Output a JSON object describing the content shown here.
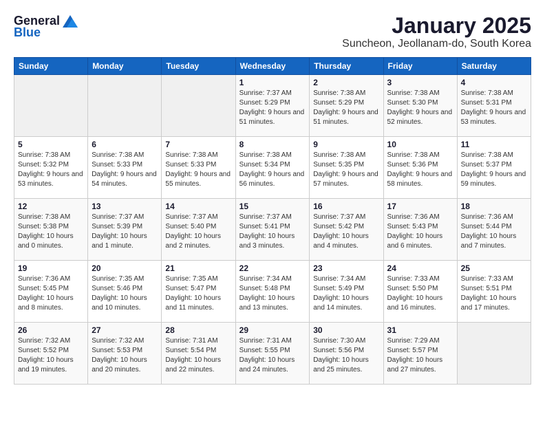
{
  "header": {
    "logo_general": "General",
    "logo_blue": "Blue",
    "title": "January 2025",
    "subtitle": "Suncheon, Jeollanam-do, South Korea"
  },
  "days_header": [
    "Sunday",
    "Monday",
    "Tuesday",
    "Wednesday",
    "Thursday",
    "Friday",
    "Saturday"
  ],
  "weeks": [
    [
      {
        "day": "",
        "info": ""
      },
      {
        "day": "",
        "info": ""
      },
      {
        "day": "",
        "info": ""
      },
      {
        "day": "1",
        "info": "Sunrise: 7:37 AM\nSunset: 5:29 PM\nDaylight: 9 hours and 51 minutes."
      },
      {
        "day": "2",
        "info": "Sunrise: 7:38 AM\nSunset: 5:29 PM\nDaylight: 9 hours and 51 minutes."
      },
      {
        "day": "3",
        "info": "Sunrise: 7:38 AM\nSunset: 5:30 PM\nDaylight: 9 hours and 52 minutes."
      },
      {
        "day": "4",
        "info": "Sunrise: 7:38 AM\nSunset: 5:31 PM\nDaylight: 9 hours and 53 minutes."
      }
    ],
    [
      {
        "day": "5",
        "info": "Sunrise: 7:38 AM\nSunset: 5:32 PM\nDaylight: 9 hours and 53 minutes."
      },
      {
        "day": "6",
        "info": "Sunrise: 7:38 AM\nSunset: 5:33 PM\nDaylight: 9 hours and 54 minutes."
      },
      {
        "day": "7",
        "info": "Sunrise: 7:38 AM\nSunset: 5:33 PM\nDaylight: 9 hours and 55 minutes."
      },
      {
        "day": "8",
        "info": "Sunrise: 7:38 AM\nSunset: 5:34 PM\nDaylight: 9 hours and 56 minutes."
      },
      {
        "day": "9",
        "info": "Sunrise: 7:38 AM\nSunset: 5:35 PM\nDaylight: 9 hours and 57 minutes."
      },
      {
        "day": "10",
        "info": "Sunrise: 7:38 AM\nSunset: 5:36 PM\nDaylight: 9 hours and 58 minutes."
      },
      {
        "day": "11",
        "info": "Sunrise: 7:38 AM\nSunset: 5:37 PM\nDaylight: 9 hours and 59 minutes."
      }
    ],
    [
      {
        "day": "12",
        "info": "Sunrise: 7:38 AM\nSunset: 5:38 PM\nDaylight: 10 hours and 0 minutes."
      },
      {
        "day": "13",
        "info": "Sunrise: 7:37 AM\nSunset: 5:39 PM\nDaylight: 10 hours and 1 minute."
      },
      {
        "day": "14",
        "info": "Sunrise: 7:37 AM\nSunset: 5:40 PM\nDaylight: 10 hours and 2 minutes."
      },
      {
        "day": "15",
        "info": "Sunrise: 7:37 AM\nSunset: 5:41 PM\nDaylight: 10 hours and 3 minutes."
      },
      {
        "day": "16",
        "info": "Sunrise: 7:37 AM\nSunset: 5:42 PM\nDaylight: 10 hours and 4 minutes."
      },
      {
        "day": "17",
        "info": "Sunrise: 7:36 AM\nSunset: 5:43 PM\nDaylight: 10 hours and 6 minutes."
      },
      {
        "day": "18",
        "info": "Sunrise: 7:36 AM\nSunset: 5:44 PM\nDaylight: 10 hours and 7 minutes."
      }
    ],
    [
      {
        "day": "19",
        "info": "Sunrise: 7:36 AM\nSunset: 5:45 PM\nDaylight: 10 hours and 8 minutes."
      },
      {
        "day": "20",
        "info": "Sunrise: 7:35 AM\nSunset: 5:46 PM\nDaylight: 10 hours and 10 minutes."
      },
      {
        "day": "21",
        "info": "Sunrise: 7:35 AM\nSunset: 5:47 PM\nDaylight: 10 hours and 11 minutes."
      },
      {
        "day": "22",
        "info": "Sunrise: 7:34 AM\nSunset: 5:48 PM\nDaylight: 10 hours and 13 minutes."
      },
      {
        "day": "23",
        "info": "Sunrise: 7:34 AM\nSunset: 5:49 PM\nDaylight: 10 hours and 14 minutes."
      },
      {
        "day": "24",
        "info": "Sunrise: 7:33 AM\nSunset: 5:50 PM\nDaylight: 10 hours and 16 minutes."
      },
      {
        "day": "25",
        "info": "Sunrise: 7:33 AM\nSunset: 5:51 PM\nDaylight: 10 hours and 17 minutes."
      }
    ],
    [
      {
        "day": "26",
        "info": "Sunrise: 7:32 AM\nSunset: 5:52 PM\nDaylight: 10 hours and 19 minutes."
      },
      {
        "day": "27",
        "info": "Sunrise: 7:32 AM\nSunset: 5:53 PM\nDaylight: 10 hours and 20 minutes."
      },
      {
        "day": "28",
        "info": "Sunrise: 7:31 AM\nSunset: 5:54 PM\nDaylight: 10 hours and 22 minutes."
      },
      {
        "day": "29",
        "info": "Sunrise: 7:31 AM\nSunset: 5:55 PM\nDaylight: 10 hours and 24 minutes."
      },
      {
        "day": "30",
        "info": "Sunrise: 7:30 AM\nSunset: 5:56 PM\nDaylight: 10 hours and 25 minutes."
      },
      {
        "day": "31",
        "info": "Sunrise: 7:29 AM\nSunset: 5:57 PM\nDaylight: 10 hours and 27 minutes."
      },
      {
        "day": "",
        "info": ""
      }
    ]
  ]
}
